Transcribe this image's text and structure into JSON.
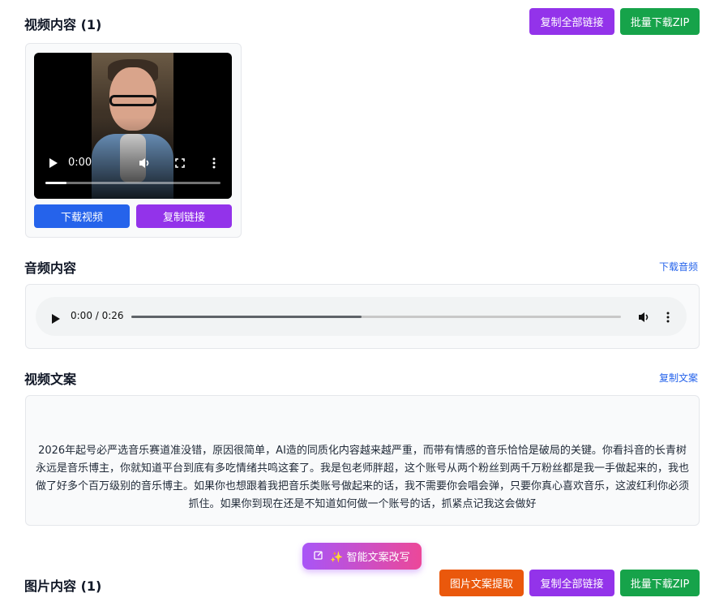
{
  "video_section": {
    "title": "视频内容 (1)",
    "copy_all_label": "复制全部链接",
    "download_zip_label": "批量下载ZIP",
    "player_time": "0:00",
    "player_progress": 0.12,
    "download_label": "下载视频",
    "copy_link_label": "复制链接"
  },
  "audio_section": {
    "title": "音频内容",
    "download_label": "下载音频",
    "time": "0:00 / 0:26",
    "progress": 0.47
  },
  "text_section": {
    "title": "视频文案",
    "copy_label": "复制文案",
    "body": "2026年起号必严选音乐赛道准没错，原因很简单，AI造的同质化内容越来越严重，而带有情感的音乐恰恰是破局的关键。你看抖音的长青树永远是音乐博主，你就知道平台到底有多吃情绪共鸣这套了。我是包老师胖超，这个账号从两个粉丝到两千万粉丝都是我一手做起来的，我也做了好多个百万级别的音乐博主。如果你也想跟着我把音乐类账号做起来的话，我不需要你会唱会弹，只要你真心喜欢音乐，这波红利你必须抓住。如果你到现在还是不知道如何做一个账号的话，抓紧点记我这会做好",
    "ai_rewrite_label": "✨ 智能文案改写"
  },
  "image_section": {
    "title": "图片内容 (1)",
    "extract_label": "图片文案提取",
    "copy_all_label": "复制全部链接",
    "download_zip_label": "批量下载ZIP"
  },
  "colors": {
    "purple": "#9333ea",
    "green": "#16a34a",
    "blue": "#2563eb",
    "orange": "#ea580c"
  },
  "icons": [
    "play-icon",
    "volume-icon",
    "fullscreen-icon",
    "more-vert-icon",
    "edit-icon"
  ]
}
